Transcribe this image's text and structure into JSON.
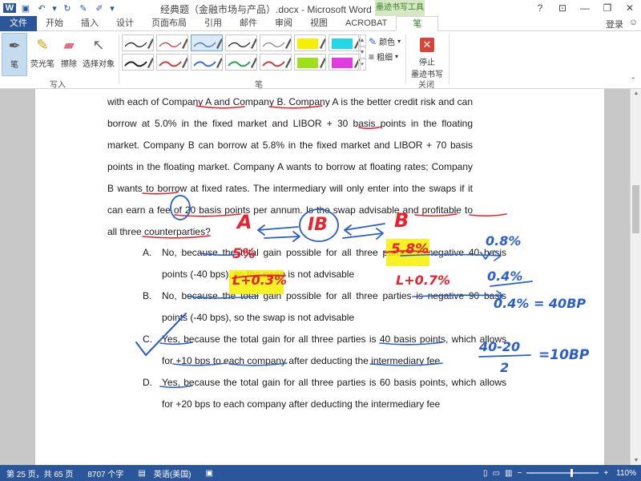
{
  "titlebar": {
    "title": "经典题（金融市场与产品）.docx - Microsoft Word",
    "tools_label": "墨迹书写工具",
    "help": "?",
    "minimize": "—",
    "restore": "❐",
    "close": "✕"
  },
  "tabs": [
    "文件",
    "开始",
    "插入",
    "设计",
    "页面布局",
    "引用",
    "邮件",
    "审阅",
    "视图",
    "ACROBAT",
    "笔"
  ],
  "login_label": "登录",
  "ribbon": {
    "write_group": {
      "label": "写入",
      "pen": "笔",
      "highlighter": "荧光笔",
      "eraser": "擦除",
      "select": "选择对象"
    },
    "pens_group": {
      "label": "笔",
      "color_label": "颜色",
      "weight_label": "粗细"
    },
    "close_group": {
      "label": "关闭",
      "stop_label_1": "停止",
      "stop_label_2": "墨迹书写"
    },
    "pen_styles": [
      {
        "color": "#222222",
        "selected": false
      },
      {
        "color": "#d23b3b",
        "selected": false
      },
      {
        "color": "#3a6fd8",
        "selected": true
      },
      {
        "color": "#222222",
        "selected": false
      },
      {
        "color": "#8a8a8a",
        "selected": false
      },
      {
        "color": "#f6f000",
        "selected": false
      },
      {
        "color": "#22d8e8",
        "selected": false
      },
      {
        "color": "#222222",
        "selected": false
      },
      {
        "color": "#d23b3b",
        "selected": false
      },
      {
        "color": "#3a6fd8",
        "selected": false
      },
      {
        "color": "#2aa34a",
        "selected": false
      },
      {
        "color": "#d23b3b",
        "selected": false
      },
      {
        "color": "#9ee01a",
        "selected": false
      },
      {
        "color": "#e23be0",
        "selected": false
      }
    ]
  },
  "document": {
    "paragraph": "with each of Company A and Company B. Company A is the better credit risk and can borrow at 5.0% in the fixed market and LIBOR + 30 basis points in the floating market. Company B can borrow at 5.8% in the fixed market and LIBOR + 70 basis points in the floating market. Company A wants to borrow at floating rates; Company B wants to borrow at fixed rates. The intermediary will only enter into the swaps if it can earn a fee of 20 basis points per annum. Is the swap advisable and profitable to all three counterparties?",
    "options": [
      {
        "letter": "A.",
        "text": "No, because the total gain possible for all three parties is negative 40 basis points (-40 bps), so the swap is not advisable"
      },
      {
        "letter": "B.",
        "text": "No, because the total gain possible for all three parties is negative 90 basis points (-40 bps), so the swap is not advisable"
      },
      {
        "letter": "C.",
        "text": "Yes, because the total gain for all three parties is 40 basis points, which allows for +10 bps to each company after deducting the intermediary fee"
      },
      {
        "letter": "D.",
        "text": "Yes, because the total gain for all three parties is 60 basis points, which allows for +20 bps to each company after deducting the intermediary fee"
      }
    ]
  },
  "ink": {
    "red_color": "#e8232f",
    "blue_color": "#2a5fc8",
    "highlight_color": "#f6f000",
    "labels": {
      "a": "A",
      "ib": "IB",
      "b": "B",
      "five_pct": "5%",
      "five_eight_pct": "5.8%",
      "l_plus_03": "L+0.3%",
      "l_plus_07": "L+0.7%",
      "zero_eight": "0.8%",
      "zero_four": "0.4%",
      "eq_40bp": "0.4% = 40BP",
      "fraction": "40-20",
      "denominator": "2",
      "eq_10bp": "=10BP"
    }
  },
  "status": {
    "page": "第 25 页，共 65 页",
    "words": "8707 个字",
    "language": "英语(美国)",
    "zoom": "110%",
    "zoom_level_fraction": 0.62
  }
}
